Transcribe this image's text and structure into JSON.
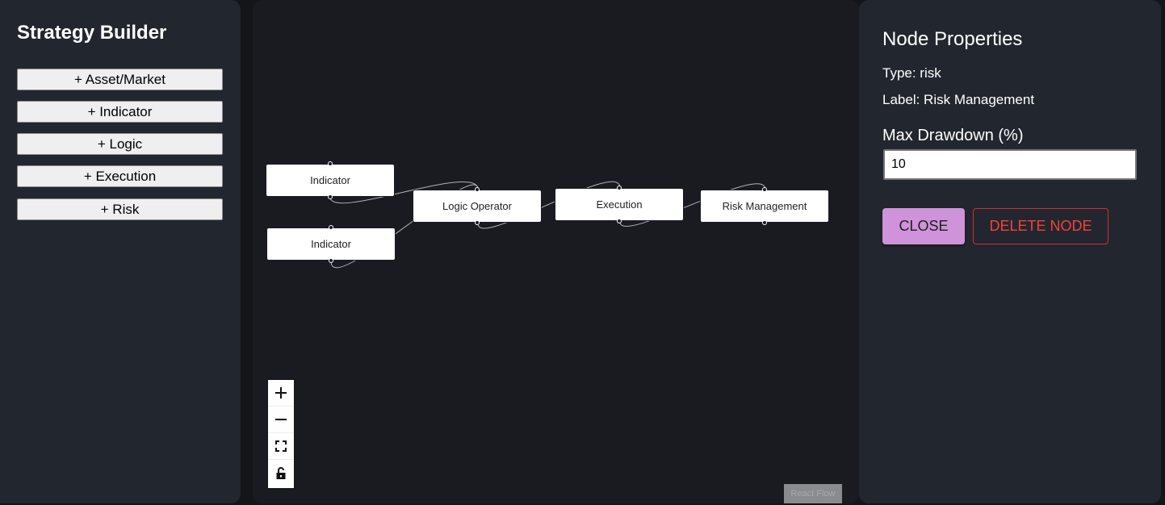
{
  "sidebar": {
    "title": "Strategy Builder",
    "buttons": [
      "+ Asset/Market",
      "+ Indicator",
      "+ Logic",
      "+ Execution",
      "+ Risk"
    ]
  },
  "canvas": {
    "nodes": [
      "Indicator",
      "Indicator",
      "Logic Operator",
      "Execution",
      "Risk Management"
    ],
    "controls": [
      "zoom-in-icon",
      "zoom-out-icon",
      "fit-view-icon",
      "lock-icon"
    ],
    "attribution": "React Flow"
  },
  "properties": {
    "title": "Node Properties",
    "type_line": "Type: risk",
    "label_line": "Label: Risk Management",
    "field_label": "Max Drawdown (%)",
    "field_value": "10",
    "close_label": "CLOSE",
    "delete_label": "DELETE NODE"
  },
  "colors": {
    "panel_bg": "#22262f",
    "canvas_bg": "#1a1b20",
    "close_button": "#ce93d8",
    "delete_button": "#f44336"
  }
}
